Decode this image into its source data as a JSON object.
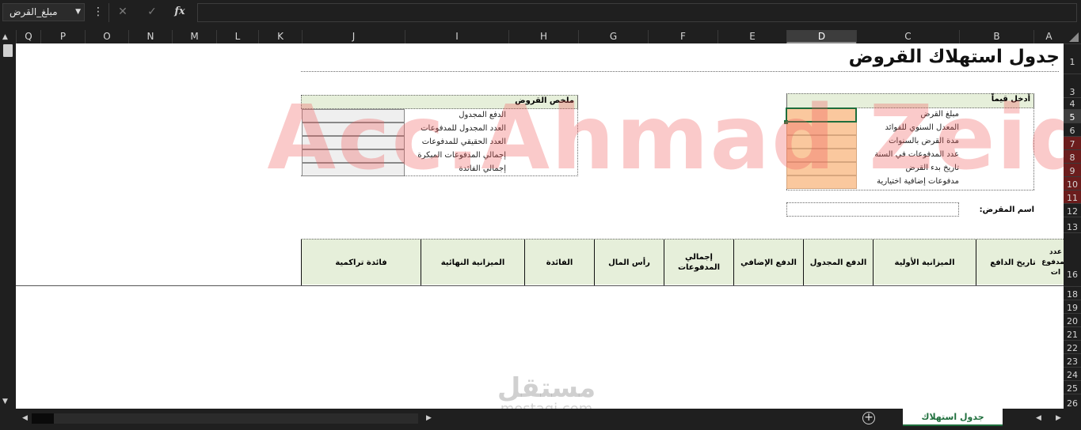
{
  "formula_bar": {
    "name_box": "مبلغ_القرض",
    "more": "⋮",
    "cancel": "✕",
    "enter": "✓",
    "fx": "fx"
  },
  "columns": [
    {
      "label": "A"
    },
    {
      "label": "B"
    },
    {
      "label": "C"
    },
    {
      "label": "D",
      "selected": true
    },
    {
      "label": "E"
    },
    {
      "label": "F"
    },
    {
      "label": "G"
    },
    {
      "label": "H"
    },
    {
      "label": "I"
    },
    {
      "label": "J"
    },
    {
      "label": "K"
    },
    {
      "label": "L"
    },
    {
      "label": "M"
    },
    {
      "label": "N"
    },
    {
      "label": "O"
    },
    {
      "label": "P"
    },
    {
      "label": "Q"
    }
  ],
  "rows": [
    "1",
    "3",
    "4",
    "5",
    "6",
    "7",
    "8",
    "9",
    "10",
    "11",
    "12",
    "13",
    "16",
    "18",
    "19",
    "20",
    "21",
    "22",
    "23",
    "24",
    "25",
    "26"
  ],
  "title": "جدول استهلاك القروض",
  "input_box": {
    "header": "أدخل قيماً",
    "labels": [
      "مبلغ القرض",
      "المعدل السنوي للفوائد",
      "مدة القرض بالسنوات",
      "عدد المدفوعات في السنة",
      "تاريخ بدء القرض",
      "مدفوعات إضافية اختيارية"
    ]
  },
  "summary_box": {
    "header": "ملخص القروض",
    "labels": [
      "الدفع المجدول",
      "العدد المجدول للمدفوعات",
      "العدد الحقيقي للمدفوعات",
      "إجمالي المدفوعات المبكرة",
      "إجمالي الفائدة"
    ]
  },
  "borrower_label": "اسم المقرض:",
  "table_headers": [
    "عدد المدفوع ات",
    "تاريخ الدافع",
    "الميزانية الأولية",
    "الدفع المجدول",
    "الدفع الإضافي",
    "إجمالي المدفوعات",
    "رأس المال",
    "الفائدة",
    "الميزانية النهائية",
    "فائدة تراكمية"
  ],
  "watermark": "Acc.Ahmad Zeid",
  "watermark_logo": {
    "ar": "مستقل",
    "en": "mostaqi.com"
  },
  "sheet_tab": "جدول استهلاك القروض",
  "colors": {
    "accent": "#1e6e3c",
    "input_fill": "#fac89e",
    "header_fill": "#e6efda"
  }
}
